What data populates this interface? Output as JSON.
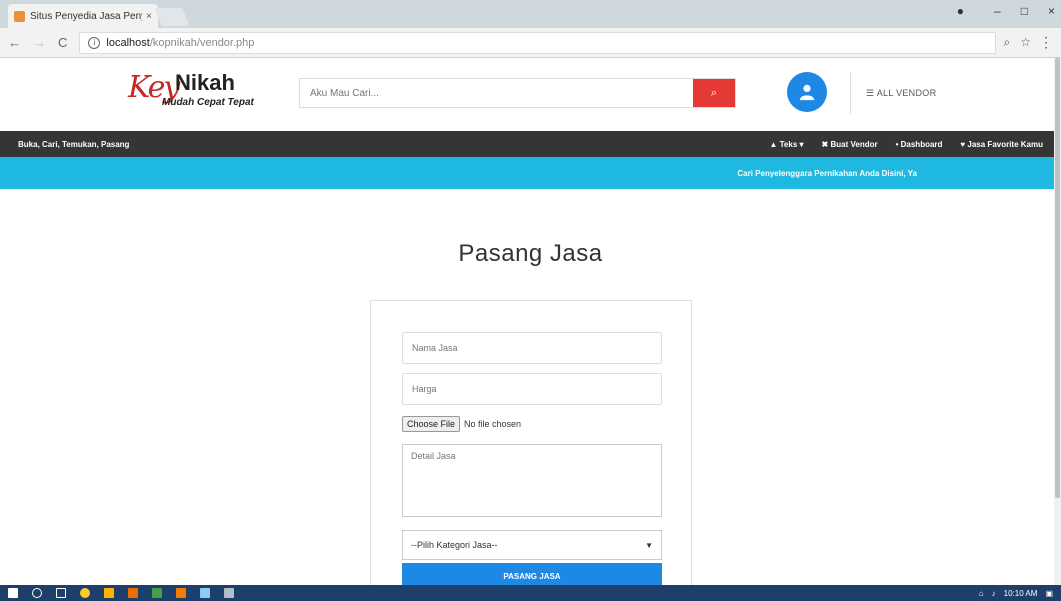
{
  "browser": {
    "tab_title": "Situs Penyedia Jasa Peny",
    "tab_close": "×",
    "url_host": "localhost",
    "url_path": "/kopnikah/vendor.php",
    "window_controls": [
      "–",
      "□",
      "×"
    ]
  },
  "header": {
    "logo_script": "Key",
    "logo_brand": "Nikah",
    "logo_tagline": "Mudah Cepat Tepat",
    "search_placeholder": "Aku Mau Cari...",
    "all_vendor": "ALL VENDOR"
  },
  "nav": {
    "tagline": "Buka, Cari, Temukan, Pasang",
    "links": [
      "Teks ▾",
      "Buat Vendor",
      "Dashboard",
      "Jasa Favorite Kamu"
    ]
  },
  "promo": {
    "text": "Cari Penyelenggara Pernikahan Anda Disini, Ya"
  },
  "page": {
    "title": "Pasang Jasa"
  },
  "form": {
    "nama_placeholder": "Nama Jasa",
    "harga_placeholder": "Harga",
    "choose_file": "Choose File",
    "no_file": "No file chosen",
    "detail_placeholder": "Detail Jasa",
    "kategori_selected": "--Pilih Kategori Jasa--",
    "submit_label": "PASANG JASA"
  },
  "taskbar": {
    "time": "10:10 AM"
  },
  "colors": {
    "accent_blue": "#1e88e5",
    "promo_cyan": "#1eb8e0",
    "search_red": "#e53935",
    "navbar_dark": "#353535"
  }
}
